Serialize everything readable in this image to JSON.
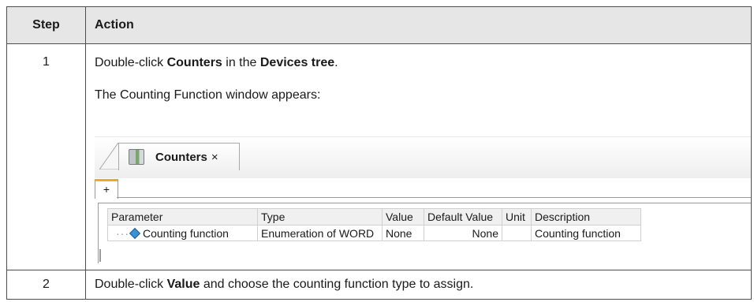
{
  "table": {
    "header": {
      "step": "Step",
      "action": "Action"
    },
    "rows": [
      {
        "step": "1",
        "line1": {
          "pre": "Double-click ",
          "bold1": "Counters",
          "mid": " in the ",
          "bold2": "Devices tree",
          "post": "."
        },
        "line2": "The Counting Function window appears:"
      },
      {
        "step": "2",
        "line": {
          "pre": "Double-click ",
          "bold": "Value",
          "post": " and choose the counting function type to assign."
        }
      }
    ]
  },
  "screenshot": {
    "tab": {
      "label": "Counters",
      "close": "×",
      "icon": "counters-device-icon"
    },
    "subtab": "+",
    "grid": {
      "headers": [
        "Parameter",
        "Type",
        "Value",
        "Default Value",
        "Unit",
        "Description"
      ],
      "row": {
        "tree": "···",
        "icon": "parameter-icon",
        "parameter": "Counting function",
        "type": "Enumeration of WORD",
        "value": "None",
        "default": "None",
        "unit": "",
        "description": "Counting function"
      }
    }
  }
}
